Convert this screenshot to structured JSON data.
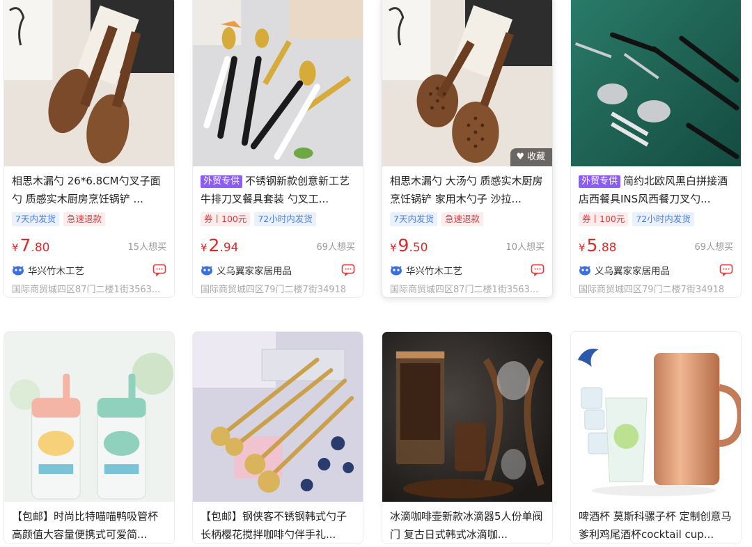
{
  "products": [
    {
      "title": "相思木漏勺 26*6.8CM勺叉子面勺 质感实木厨房烹饪锅铲 ...",
      "trade_tag": "",
      "tags": [
        {
          "text": "7天内发货",
          "color": "blue"
        },
        {
          "text": "急速退款",
          "color": "red"
        }
      ],
      "price_int": "7",
      "price_dec": ".80",
      "currency": "¥",
      "want": "15人想买",
      "shop": "华兴竹木工艺",
      "address": "国际商贸城四区87门二楼1街3563...",
      "image": "wooden-spoon-fork"
    },
    {
      "title": "不锈钢新款创意新工艺牛排刀叉餐具套装 勺叉工...",
      "trade_tag": "外贸专供",
      "tags": [
        {
          "text": "券丨100元",
          "color": "red"
        },
        {
          "text": "72小时内发货",
          "color": "blue"
        }
      ],
      "price_int": "2",
      "price_dec": ".94",
      "currency": "¥",
      "want": "69人想买",
      "shop": "义乌翼家家居用品",
      "address": "国际商贸城四区79门二楼7街34918",
      "image": "gold-cutlery-set"
    },
    {
      "title": "相思木漏勺 大汤勺 质感实木厨房烹饪锅铲 家用木勺子 沙拉...",
      "trade_tag": "",
      "tags": [
        {
          "text": "7天内发货",
          "color": "blue"
        },
        {
          "text": "急速退款",
          "color": "red"
        }
      ],
      "price_int": "9",
      "price_dec": ".50",
      "currency": "¥",
      "want": "10人想买",
      "shop": "华兴竹木工艺",
      "address": "国际商贸城四区87门二楼1街3563...",
      "image": "wooden-slotted-spoons",
      "favorite_label": "收藏"
    },
    {
      "title": "简约北欧风黑白拼接酒店西餐具INS风西餐刀叉勺...",
      "trade_tag": "外贸专供",
      "tags": [
        {
          "text": "券丨100元",
          "color": "red"
        },
        {
          "text": "72小时内发货",
          "color": "blue"
        }
      ],
      "price_int": "5",
      "price_dec": ".88",
      "currency": "¥",
      "want": "69人想买",
      "shop": "义乌翼家家居用品",
      "address": "国际商贸城四区79门二楼7街34918",
      "image": "black-cutlery-green"
    },
    {
      "title": "【包邮】时尚比特喵喵鸭吸管杯高颜值大容量便携式可爱简...",
      "trade_tag": "",
      "image": "kids-water-bottles"
    },
    {
      "title": "【包邮】钢侠客不锈钢韩式勺子长柄樱花搅拌咖啡勺伴手礼...",
      "trade_tag": "",
      "image": "gold-flower-spoons"
    },
    {
      "title": "冰滴咖啡壶新款冰滴器5人份单阀门 复古日式韩式冰滴咖...",
      "trade_tag": "",
      "image": "cold-drip-coffee"
    },
    {
      "title": "啤酒杯 莫斯科骡子杯 定制创意马爹利鸡尾酒杯cocktail cup...",
      "trade_tag": "",
      "image": "copper-mule-mug"
    }
  ],
  "colors": {
    "price": "#e02828",
    "trade_tag_bg": "#8b5cf6",
    "tag_blue": "#4a7ee0",
    "tag_red": "#e0393e"
  }
}
